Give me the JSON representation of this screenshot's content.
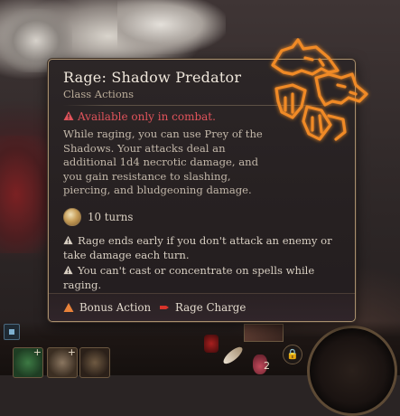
{
  "tooltip": {
    "title": "Rage: Shadow Predator",
    "subtitle": "Class Actions",
    "combat_warning": "Available only in combat.",
    "description": "While raging, you can use Prey of the Shadows. Your attacks deal an additional 1d4 necrotic damage, and you gain resistance to slashing, piercing, and bludgeoning damage.",
    "duration": "10 turns",
    "notes": [
      "Rage ends early if you don't attack an enemy or take damage each turn.",
      "You can't cast or concentrate on spells while raging."
    ],
    "costs": [
      {
        "label": "Bonus Action",
        "icon": "triangle-icon",
        "color": "#e8823a"
      },
      {
        "label": "Rage Charge",
        "icon": "rage-charge-icon",
        "color": "#d8342b"
      }
    ],
    "icon": "wolf-rage-icon"
  },
  "hotbar": {
    "stack_count": "2"
  },
  "colors": {
    "accent_gold": "#a88f6d",
    "warning_red": "#e0535b",
    "rage_orange": "#f0892a"
  }
}
